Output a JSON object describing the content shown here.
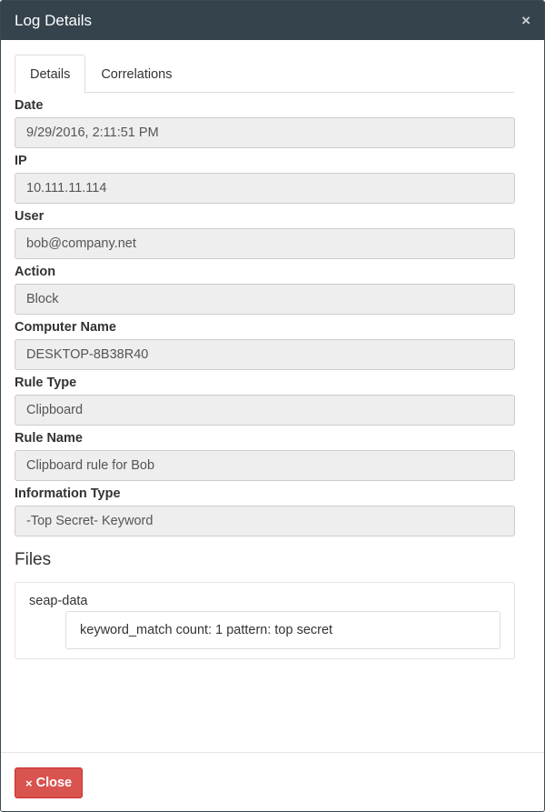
{
  "modal": {
    "title": "Log Details",
    "close_glyph": "×"
  },
  "tabs": [
    {
      "label": "Details",
      "active": true
    },
    {
      "label": "Correlations",
      "active": false
    }
  ],
  "fields": [
    {
      "label": "Date",
      "value": "9/29/2016, 2:11:51 PM"
    },
    {
      "label": "IP",
      "value": "10.111.11.114"
    },
    {
      "label": "User",
      "value": "bob@company.net"
    },
    {
      "label": "Action",
      "value": "Block"
    },
    {
      "label": "Computer Name",
      "value": "DESKTOP-8B38R40"
    },
    {
      "label": "Rule Type",
      "value": "Clipboard"
    },
    {
      "label": "Rule Name",
      "value": "Clipboard rule for Bob"
    },
    {
      "label": "Information Type",
      "value": "-Top Secret- Keyword"
    }
  ],
  "files": {
    "title": "Files",
    "items": [
      {
        "name": "seap-data",
        "detail": "keyword_match count: 1 pattern: top secret"
      }
    ]
  },
  "footer": {
    "close_label": "Close",
    "close_icon": "×",
    "close_color": "#d9534f"
  },
  "colors": {
    "header_bg": "#34434c",
    "input_bg": "#eeeeee"
  }
}
